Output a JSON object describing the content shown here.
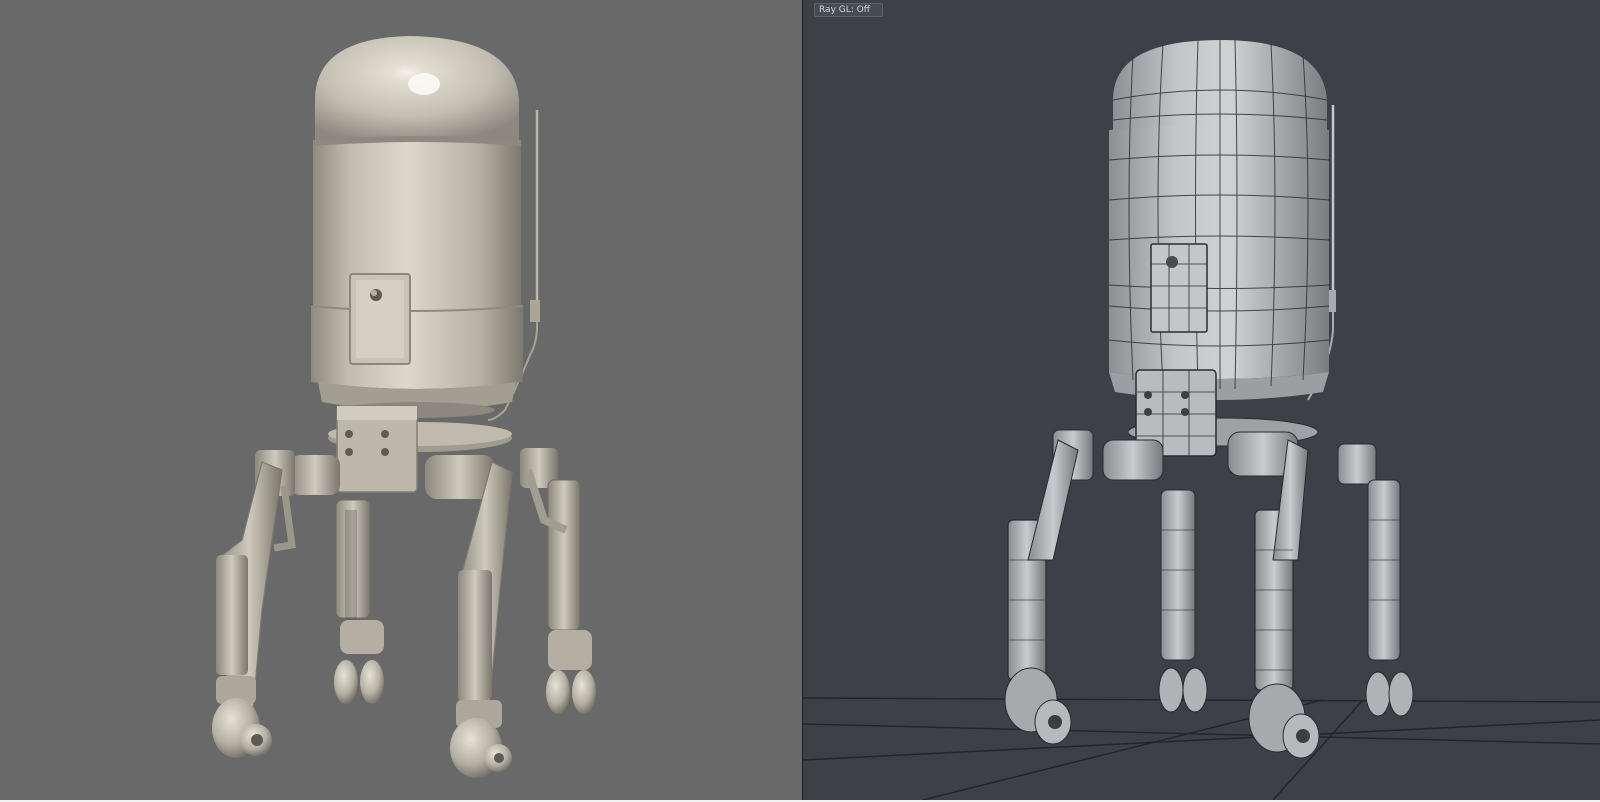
{
  "viewports": {
    "left": {
      "mode": "shaded-render"
    },
    "right": {
      "mode": "wireframe-on-shaded",
      "ray_gl_label": "Ray GL: Off"
    }
  },
  "colors": {
    "left_background": "#696969",
    "right_background": "#3d4047",
    "model_surface": "#cbc6b8",
    "wire_surface": "#b4b6b9",
    "wire_lines": "#2a2b2e",
    "ground_grid": "#23262b"
  }
}
